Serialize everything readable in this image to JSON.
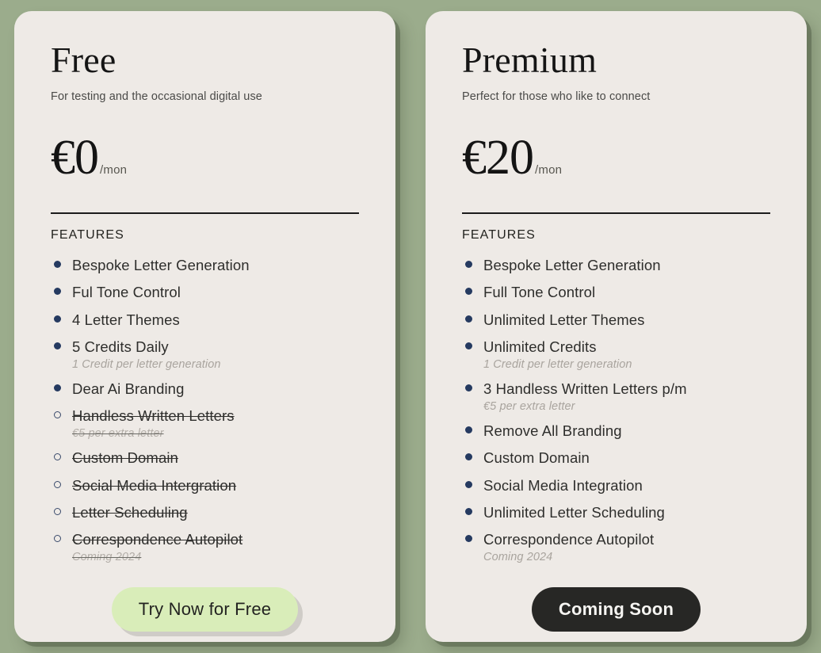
{
  "page": {
    "background_color": "#9bac8c",
    "card_background_color": "#eeeae6",
    "bullet_color": "#253a60"
  },
  "plans": [
    {
      "name": "Free",
      "tagline": "For testing and the occasional digital use",
      "price_amount": "€0",
      "price_period": "/mon",
      "features_label": "FEATURES",
      "features": [
        {
          "title": "Bespoke Letter Generation",
          "note": "",
          "included": true
        },
        {
          "title": "Ful Tone Control",
          "note": "",
          "included": true
        },
        {
          "title": "4 Letter Themes",
          "note": "",
          "included": true
        },
        {
          "title": "5 Credits Daily",
          "note": "1 Credit per letter generation",
          "included": true
        },
        {
          "title": "Dear Ai Branding",
          "note": "",
          "included": true
        },
        {
          "title": "Handless Written Letters",
          "note": "€5 per extra letter",
          "included": false
        },
        {
          "title": "Custom Domain",
          "note": "",
          "included": false
        },
        {
          "title": "Social Media Intergration",
          "note": "",
          "included": false
        },
        {
          "title": "Letter Scheduling",
          "note": "",
          "included": false
        },
        {
          "title": "Correspondence Autopilot",
          "note": "Coming 2024",
          "included": false
        }
      ],
      "cta_label": "Try Now for Free",
      "cta_style": "light",
      "cta_color": "#d9edb9"
    },
    {
      "name": "Premium",
      "tagline": "Perfect for those who like to connect",
      "price_amount": "€20",
      "price_period": "/mon",
      "features_label": "FEATURES",
      "features": [
        {
          "title": "Bespoke Letter Generation",
          "note": "",
          "included": true
        },
        {
          "title": "Full Tone Control",
          "note": "",
          "included": true
        },
        {
          "title": "Unlimited Letter Themes",
          "note": "",
          "included": true
        },
        {
          "title": "Unlimited Credits",
          "note": "1 Credit per letter generation",
          "included": true
        },
        {
          "title": "3 Handless Written Letters p/m",
          "note": "€5 per extra letter",
          "included": true
        },
        {
          "title": "Remove All Branding",
          "note": "",
          "included": true
        },
        {
          "title": "Custom Domain",
          "note": "",
          "included": true
        },
        {
          "title": "Social Media Integration",
          "note": "",
          "included": true
        },
        {
          "title": "Unlimited Letter Scheduling",
          "note": "",
          "included": true
        },
        {
          "title": "Correspondence Autopilot",
          "note": "Coming 2024",
          "included": true
        }
      ],
      "cta_label": "Coming Soon",
      "cta_style": "dark",
      "cta_color": "#272725"
    }
  ]
}
